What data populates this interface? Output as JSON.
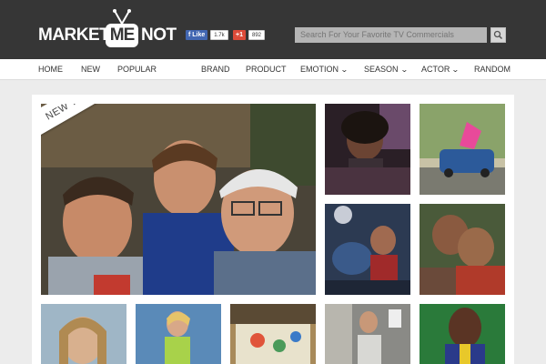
{
  "header": {
    "logo": {
      "word1": "MARKET",
      "badge": "ME",
      "word2": "NOT"
    },
    "social": {
      "facebook": {
        "label": "Like",
        "count": "1.7k"
      },
      "googleplus": {
        "label": "+1",
        "count": "892"
      }
    },
    "search": {
      "placeholder": "Search For Your Favorite TV Commercials"
    }
  },
  "nav": {
    "items": [
      {
        "label": "HOME",
        "dropdown": false
      },
      {
        "label": "NEW",
        "dropdown": false
      },
      {
        "label": "POPULAR",
        "dropdown": false
      },
      {
        "label": "BRAND",
        "dropdown": false
      },
      {
        "label": "PRODUCT",
        "dropdown": false
      },
      {
        "label": "EMOTION",
        "dropdown": true
      },
      {
        "label": "SEASON",
        "dropdown": true
      },
      {
        "label": "ACTOR",
        "dropdown": true
      },
      {
        "label": "RANDOM",
        "dropdown": false
      }
    ]
  },
  "featured": {
    "ribbon": "NEW TV COMMERCIALS"
  },
  "colors": {
    "header_bg": "#363636",
    "nav_bg": "#ffffff",
    "page_bg": "#ececec",
    "search_bg": "#b5b5b5"
  }
}
